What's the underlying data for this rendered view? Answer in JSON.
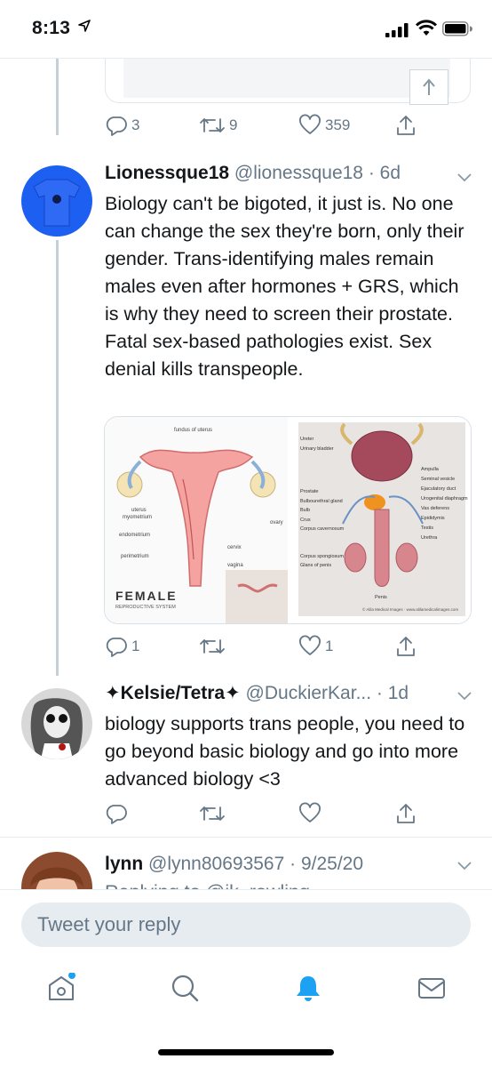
{
  "status_bar": {
    "time": "8:13"
  },
  "previous_tweet": {
    "actions": {
      "replies": "3",
      "retweets": "9",
      "likes": "359"
    }
  },
  "tweets": [
    {
      "name": "Lionessque18",
      "handle": "@lionessque18",
      "time": "· 6d",
      "text": "Biology can't be bigoted, it just is. No one can change the sex they're born, only their gender. Trans-identifying males remain males even after hormones + GRS, which is why they need to screen their prostate. Fatal sex-based pathologies exist. Sex denial kills transpeople.",
      "media": {
        "left": {
          "title": "FEMALE",
          "subtitle": "REPRODUCTIVE SYSTEM",
          "labels": [
            "fundus of uterus",
            "uterus",
            "myometrium",
            "endometrium",
            "perimetrium",
            "cervix",
            "vagina",
            "ovary"
          ]
        },
        "right": {
          "labels_left": [
            "Ureter",
            "Urinary bladder",
            "Prostate",
            "Bulbourethral gland",
            "Bulb",
            "Crus",
            "Corpus cavernosum",
            "Corpus spongiosum",
            "Glans of penis"
          ],
          "labels_right": [
            "Ampulla",
            "Seminal vesicle",
            "Ejaculatory duct",
            "Urogenital diaphragm",
            "Vas deferens",
            "Epididymis",
            "Testis",
            "Urethra"
          ],
          "bottom_label": "Penis",
          "credit": "© Alila Medical Images · www.alilamedicalimages.com"
        }
      },
      "actions": {
        "replies": "1",
        "retweets": "",
        "likes": "1"
      }
    },
    {
      "name": "✦Kelsie/Tetra✦",
      "handle": "@DuckierKar...",
      "time": "· 1d",
      "text": "biology supports trans people, you need to go beyond basic biology and go into more advanced biology <3",
      "actions": {
        "replies": "",
        "retweets": "",
        "likes": ""
      }
    },
    {
      "name": "lynn",
      "handle": "@lynn80693567",
      "time": "· 9/25/20",
      "partial_text": "Replying to @jk_rowling"
    }
  ],
  "reply_bar": {
    "placeholder": "Tweet your reply"
  },
  "tab_bar": [
    "home-icon",
    "search-icon",
    "notifications-icon",
    "messages-icon"
  ],
  "colors": {
    "accent": "#1da1f2",
    "muted": "#657786",
    "divider": "#e6ecf0"
  }
}
